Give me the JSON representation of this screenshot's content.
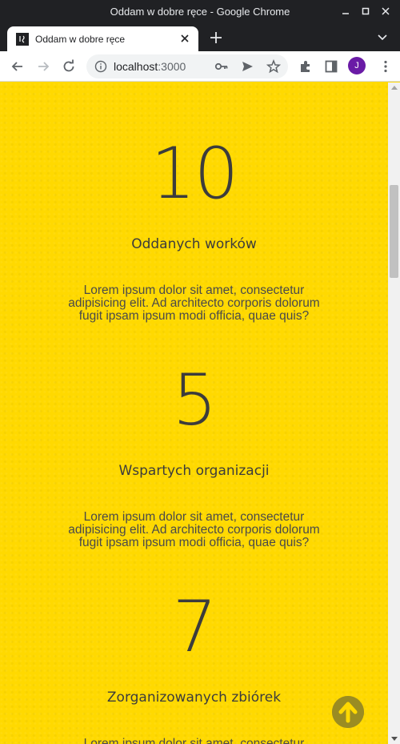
{
  "window": {
    "title": "Oddam w dobre ręce - Google Chrome"
  },
  "tab": {
    "title": "Oddam w dobre ręce"
  },
  "address_bar": {
    "host": "localhost",
    "port": ":3000"
  },
  "profile": {
    "initial": "J"
  },
  "stats": [
    {
      "number": "10",
      "label": "Oddanych worków",
      "description": "Lorem ipsum dolor sit amet, consectetur adipisicing elit. Ad architecto corporis dolorum fugit ipsam ipsum modi officia, quae quis?"
    },
    {
      "number": "5",
      "label": "Wspartych organizacji",
      "description": "Lorem ipsum dolor sit amet, consectetur adipisicing elit. Ad architecto corporis dolorum fugit ipsam ipsum modi officia, quae quis?"
    },
    {
      "number": "7",
      "label": "Zorganizowanych zbiórek",
      "description": "Lorem ipsum dolor sit amet, consectetur adipisicing elit. Ad architecto corporis dolorum fugit ipsam ipsum modi officia, quae quis?"
    }
  ],
  "colors": {
    "background": "#ffd900",
    "text": "#3c3c3c",
    "scroll_button": "#9a8c22"
  },
  "icons": {
    "back": "arrow-left-icon",
    "forward": "arrow-right-icon",
    "reload": "reload-icon",
    "info": "info-icon",
    "key": "key-icon",
    "send": "send-icon",
    "bookmark": "star-icon",
    "extensions": "puzzle-icon",
    "side_panel": "side-panel-icon",
    "menu": "kebab-menu-icon",
    "scroll_top": "arrow-up-circle-icon"
  }
}
